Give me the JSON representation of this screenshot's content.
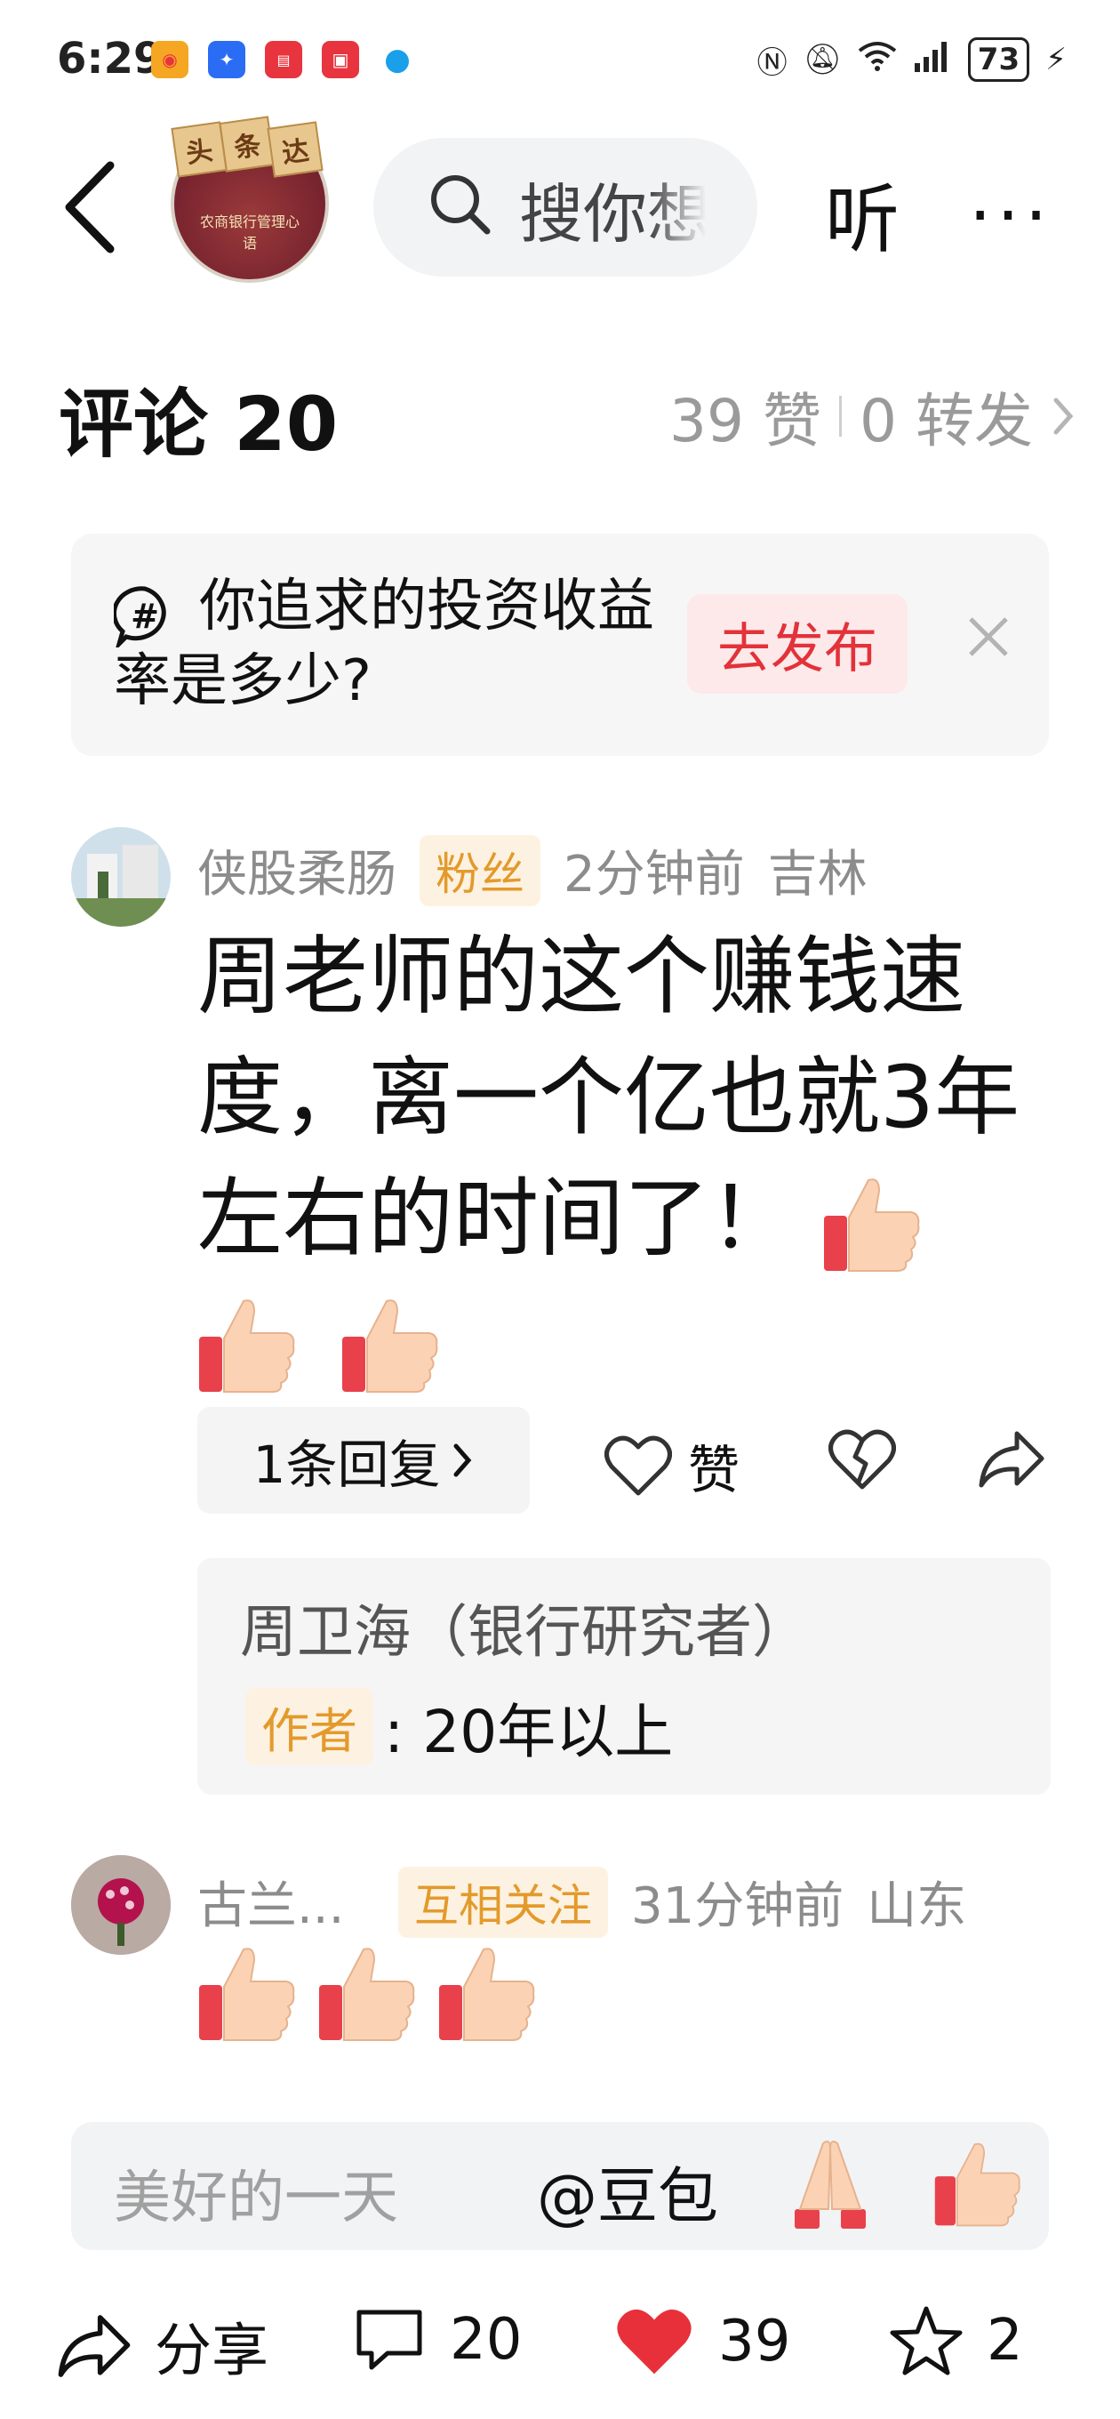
{
  "status_bar": {
    "time": "6:29",
    "battery": "73",
    "app_icons": [
      {
        "name": "weibo-icon",
        "color": "#f5a623",
        "glyph": "微"
      },
      {
        "name": "bulb-app-icon",
        "color": "#2a6df4",
        "glyph": "✦"
      },
      {
        "name": "toutiao-icon",
        "color": "#e8343f",
        "glyph": "头条"
      },
      {
        "name": "tv-app-icon",
        "color": "#e8343f",
        "glyph": "▣"
      },
      {
        "name": "edge-icon",
        "color": "#1aa0e8",
        "glyph": "e"
      }
    ]
  },
  "header": {
    "search_placeholder": "搜你想",
    "listen_label": "听",
    "more_label": "···",
    "avatar_badge": [
      "头",
      "条",
      "达"
    ],
    "avatar_book_title": "农商银行管理心语"
  },
  "comments_header": {
    "title": "评论 20",
    "likes": "39 赞",
    "reposts": "0 转发"
  },
  "topic_card": {
    "text": "你追求的投资收益率是多少?",
    "button": "去发布"
  },
  "comments": [
    {
      "user": "侠股柔肠",
      "tag": "粉丝",
      "time": "2分钟前",
      "location": "吉林",
      "text": "周老师的这个赚钱速度，离一个亿也就3年左右的时间了！",
      "reply_count_label": "1条回复",
      "like_label": "赞",
      "author_reply": {
        "author": "周卫海（银行研究者）",
        "tag": "作者",
        "text": ": 20年以上"
      }
    },
    {
      "user": "古兰...",
      "tag": "互相关注",
      "time": "31分钟前",
      "location": "山东"
    }
  ],
  "input_bar": {
    "placeholder": "美好的一天",
    "mention": "@豆包"
  },
  "bottom_bar": {
    "share_label": "分享",
    "comment_count": "20",
    "like_count": "39",
    "favorite_count": "2"
  },
  "colors": {
    "accent_red": "#e2323a",
    "tag_orange": "#e39a2c"
  }
}
